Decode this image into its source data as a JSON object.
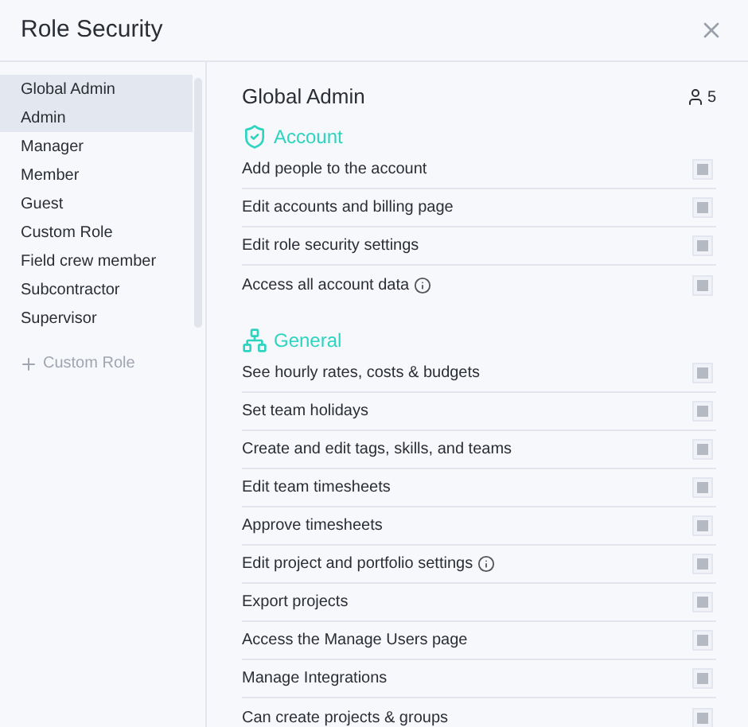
{
  "window": {
    "title": "Role Security"
  },
  "sidebar": {
    "items": [
      {
        "label": "Global Admin",
        "selected": true
      },
      {
        "label": "Admin",
        "selected": true
      },
      {
        "label": "Manager",
        "selected": false
      },
      {
        "label": "Member",
        "selected": false
      },
      {
        "label": "Guest",
        "selected": false
      },
      {
        "label": "Custom Role",
        "selected": false
      },
      {
        "label": "Field crew member",
        "selected": false
      },
      {
        "label": "Subcontractor",
        "selected": false
      },
      {
        "label": "Supervisor",
        "selected": false
      }
    ],
    "add_button": "Custom Role"
  },
  "role": {
    "title": "Global Admin",
    "member_count": "5"
  },
  "sections": [
    {
      "kind": "account",
      "title": "Account",
      "permissions": [
        {
          "label": "Add people to the account",
          "info": false,
          "checked": true
        },
        {
          "label": "Edit accounts and billing page",
          "info": false,
          "checked": true
        },
        {
          "label": "Edit role security settings",
          "info": false,
          "checked": true
        },
        {
          "label": "Access all account data",
          "info": true,
          "checked": true
        }
      ]
    },
    {
      "kind": "general",
      "title": "General",
      "permissions": [
        {
          "label": "See hourly rates, costs & budgets",
          "info": false,
          "checked": true
        },
        {
          "label": "Set team holidays",
          "info": false,
          "checked": true
        },
        {
          "label": "Create and edit tags, skills, and teams",
          "info": false,
          "checked": true
        },
        {
          "label": "Edit team timesheets",
          "info": false,
          "checked": true
        },
        {
          "label": "Approve timesheets",
          "info": false,
          "checked": true
        },
        {
          "label": "Edit project and portfolio settings",
          "info": true,
          "checked": true
        },
        {
          "label": "Export projects",
          "info": false,
          "checked": true
        },
        {
          "label": "Access the Manage Users page",
          "info": false,
          "checked": true
        },
        {
          "label": "Manage Integrations",
          "info": false,
          "checked": true
        },
        {
          "label": "Can create projects & groups",
          "info": false,
          "checked": true
        }
      ]
    }
  ]
}
